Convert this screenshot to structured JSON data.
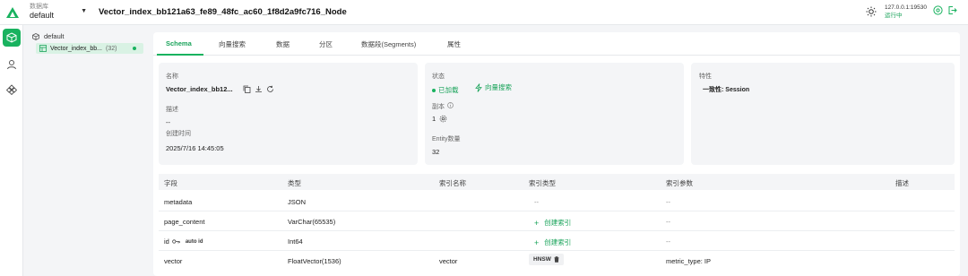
{
  "header": {
    "db_caption": "数据库",
    "db_value": "default",
    "collection_title": "Vector_index_bb121a63_fe89_48fc_ac60_1f8d2a9fc716_Node",
    "server_address": "127.0.0.1:19530",
    "server_status": "运行中",
    "icons": [
      "theme-toggle-icon",
      "help-icon",
      "logout-icon"
    ]
  },
  "rail": {
    "items": [
      {
        "icon": "cube-icon",
        "active": true
      },
      {
        "icon": "user-icon",
        "active": false
      },
      {
        "icon": "nodes-icon",
        "active": false
      }
    ]
  },
  "tree": {
    "database": "default",
    "collection": "Vector_index_bb...",
    "collection_count": "(32)"
  },
  "tabs": [
    "Schema",
    "向量搜索",
    "数据",
    "分区",
    "数据段(Segments)",
    "属性"
  ],
  "active_tab": 0,
  "info": {
    "name_label": "名称",
    "name_value": "Vector_index_bb12...",
    "description_label": "描述",
    "description_value": "--",
    "created_label": "创建时间",
    "created_value": "2025/7/16 14:45:05",
    "status_label": "状态",
    "status_loaded": "已加载",
    "vector_search_link": "向量搜索",
    "replica_label": "副本",
    "replica_value": "1",
    "entity_label": "Entity数量",
    "entity_value": "32",
    "features_label": "特性",
    "consistency": "一致性: Session"
  },
  "schema_table": {
    "columns": [
      "字段",
      "类型",
      "索引名称",
      "索引类型",
      "索引参数",
      "描述"
    ],
    "create_index_label": "创建索引",
    "rows": [
      {
        "field": "metadata",
        "type": "JSON",
        "index_name": "",
        "index_type": "--",
        "index_params": "--",
        "is_pk": false,
        "create_index": false
      },
      {
        "field": "page_content",
        "type": "VarChar(65535)",
        "index_name": "",
        "index_type": "",
        "index_params": "--",
        "is_pk": false,
        "create_index": true
      },
      {
        "field": "id",
        "type": "Int64",
        "index_name": "",
        "index_type": "",
        "index_params": "--",
        "is_pk": true,
        "auto_id": "auto id",
        "create_index": true
      },
      {
        "field": "vector",
        "type": "FloatVector(1536)",
        "index_name": "vector",
        "index_type": "HNSW",
        "index_params": "metric_type: IP",
        "is_pk": false,
        "create_index": false
      }
    ]
  },
  "colors": {
    "accent": "#19b25f",
    "accent_text": "#19a35a",
    "page_bg": "#f4f5f7"
  }
}
